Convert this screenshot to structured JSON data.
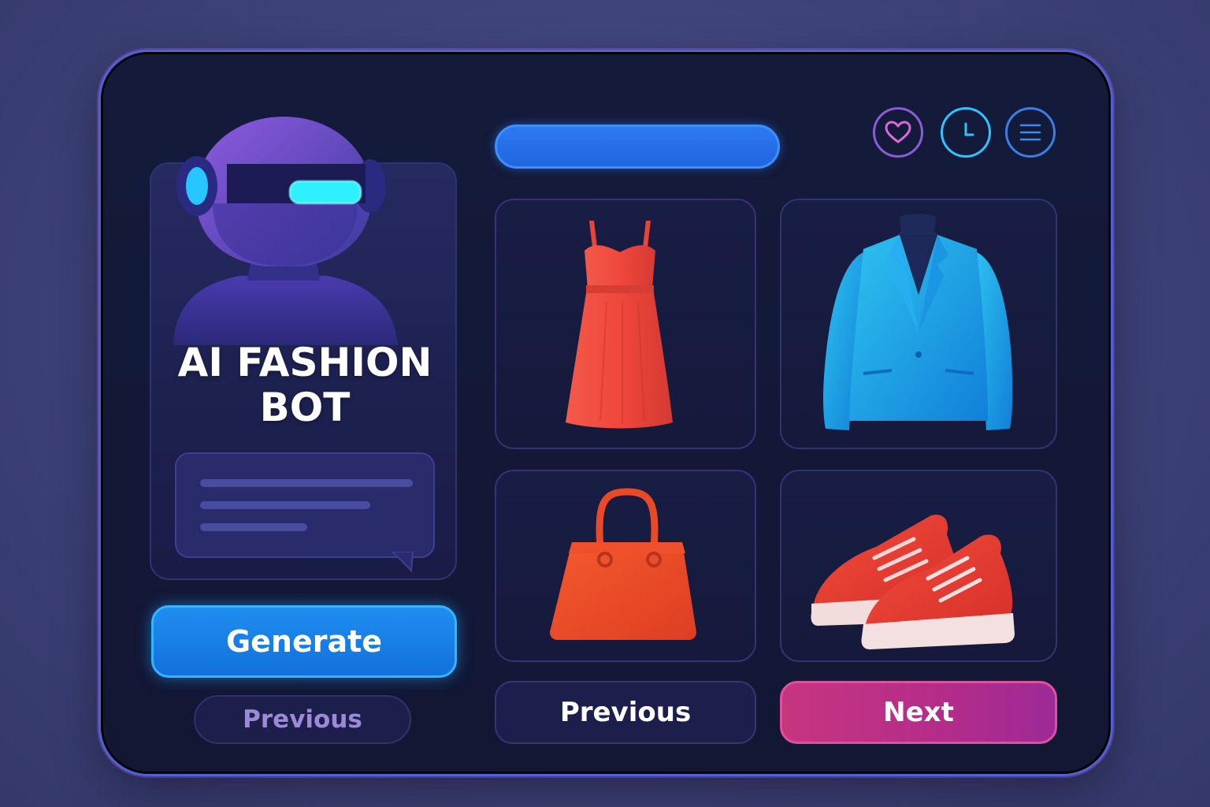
{
  "bot": {
    "title_line1": "AI FASHION",
    "title_line2": "BOT"
  },
  "buttons": {
    "generate": "Generate",
    "previous_left": "Previous",
    "previous": "Previous",
    "next": "Next"
  },
  "icons": {
    "favorite": "heart-icon",
    "history": "clock-icon",
    "menu": "menu-icon"
  },
  "products": [
    {
      "item": "dress",
      "color": "#f0473c"
    },
    {
      "item": "blazer",
      "color": "#1fa6e8"
    },
    {
      "item": "handbag",
      "color": "#ee4a2a"
    },
    {
      "item": "sneakers",
      "color": "#e8392f"
    }
  ],
  "colors": {
    "accent_blue": "#1e8ef0",
    "accent_pink": "#c7357f",
    "panel": "#141a3a"
  }
}
